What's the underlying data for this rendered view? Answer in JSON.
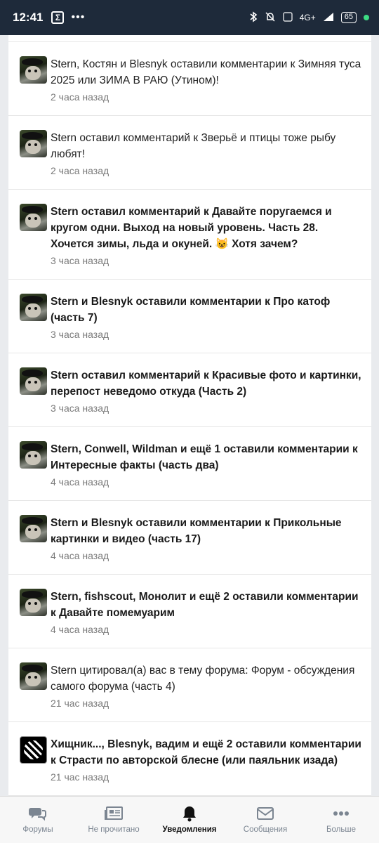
{
  "status_bar": {
    "time": "12:41",
    "app_icon_glyph": "Σ",
    "more": "•••",
    "network": "4G+",
    "battery": "65"
  },
  "notifications": [
    {
      "text": "Stern, Костян и Blesnyk оставили комментарии к Зимняя туса 2025 или ЗИМА В РАЮ (Утином)!",
      "time": "2 часа назад",
      "unread": false,
      "avatar": "stern"
    },
    {
      "text": "Stern оставил комментарий к Зверьё и птицы тоже рыбу любят!",
      "time": "2 часа назад",
      "unread": false,
      "avatar": "stern"
    },
    {
      "text": "Stern оставил комментарий к Давайте поругаемся и кругом одни. Выход на новый уровень. Часть 28. Хочется зимы, льда и окуней. 😺 Хотя зачем?",
      "time": "3 часа назад",
      "unread": true,
      "avatar": "stern"
    },
    {
      "text": "Stern и Blesnyk оставили комментарии к Про катоф (часть 7)",
      "time": "3 часа назад",
      "unread": true,
      "avatar": "stern"
    },
    {
      "text": "Stern оставил комментарий к Красивые фото и картинки, перепост неведомо откуда (Часть 2)",
      "time": "3 часа назад",
      "unread": true,
      "avatar": "stern"
    },
    {
      "text": "Stern, Conwell, Wildman и ещё 1 оставили комментарии к Интересные факты (часть два)",
      "time": "4 часа назад",
      "unread": true,
      "avatar": "stern"
    },
    {
      "text": "Stern и Blesnyk оставили комментарии к Прикольные картинки и видео (часть 17)",
      "time": "4 часа назад",
      "unread": true,
      "avatar": "stern"
    },
    {
      "text": "Stern, fishscout, Монолит и ещё 2 оставили комментарии к Давайте помемуарим",
      "time": "4 часа назад",
      "unread": true,
      "avatar": "stern"
    },
    {
      "text": "Stern цитировал(а) вас в тему форума: Форум - обсуждения самого форума (часть 4)",
      "time": "21 час назад",
      "unread": false,
      "avatar": "stern"
    },
    {
      "text": "Хищник..., Blesnyk, вадим и ещё 2 оставили комментарии к Страсти по авторской блесне (или паяльник изада)",
      "time": "21 час назад",
      "unread": true,
      "avatar": "hischnik"
    }
  ],
  "bottom_nav": [
    {
      "label": "Форумы",
      "icon": "forums-icon",
      "active": false
    },
    {
      "label": "Не прочитано",
      "icon": "unread-icon",
      "active": false
    },
    {
      "label": "Уведомления",
      "icon": "bell-icon",
      "active": true
    },
    {
      "label": "Сообщения",
      "icon": "envelope-icon",
      "active": false
    },
    {
      "label": "Больше",
      "icon": "more-icon",
      "active": false
    }
  ]
}
